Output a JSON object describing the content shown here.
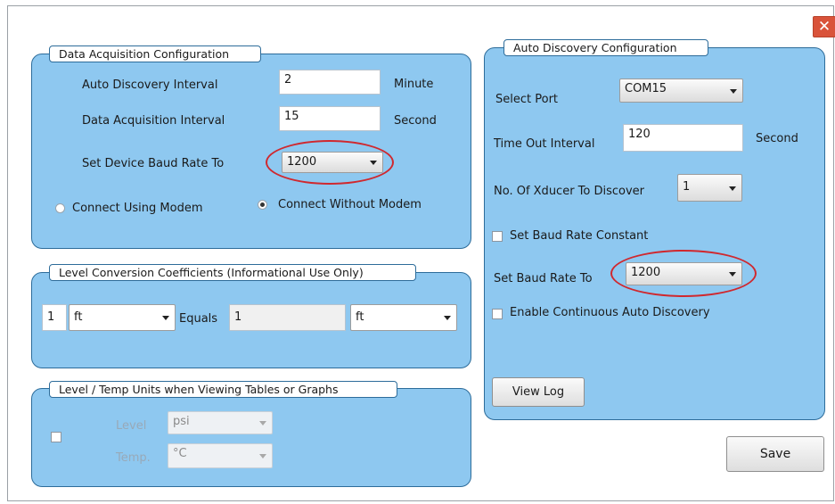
{
  "close_label": "✕",
  "data_acq": {
    "title": "Data Acquisition Configuration",
    "auto_discovery_label": "Auto Discovery Interval",
    "auto_discovery_value": "2",
    "auto_discovery_unit": "Minute",
    "data_acq_label": "Data Acquisition Interval",
    "data_acq_value": "15",
    "data_acq_unit": "Second",
    "baud_label": "Set Device  Baud Rate To",
    "baud_value": "1200",
    "radio_modem": "Connect Using Modem",
    "radio_no_modem": "Connect Without Modem",
    "selected_radio": "Connect Without Modem"
  },
  "level_conv": {
    "title": "Level Conversion Coefficients (Informational Use Only)",
    "qty": "1",
    "unit_left": "ft",
    "equals": "Equals",
    "value": "1",
    "unit_right": "ft"
  },
  "units": {
    "title": "Level / Temp Units when Viewing Tables or Graphs",
    "checked": false,
    "level_label": "Level",
    "level_value": "psi",
    "temp_label": "Temp.",
    "temp_value": "°C"
  },
  "auto_disc": {
    "title": "Auto Discovery Configuration",
    "port_label": "Select Port",
    "port_value": "COM15",
    "timeout_label": "Time Out Interval",
    "timeout_value": "120",
    "timeout_unit": "Second",
    "xducer_label": "No. Of  Xducer To Discover",
    "xducer_value": "1",
    "baud_const_label": "Set Baud Rate Constant",
    "baud_const_checked": false,
    "baud_label": "Set Baud Rate To",
    "baud_value": "1200",
    "continuous_label": "Enable Continuous Auto Discovery",
    "continuous_checked": false,
    "view_log": "View Log"
  },
  "save": "Save",
  "highlight_color": "#d0282e",
  "group_color": "#8ec8f0"
}
